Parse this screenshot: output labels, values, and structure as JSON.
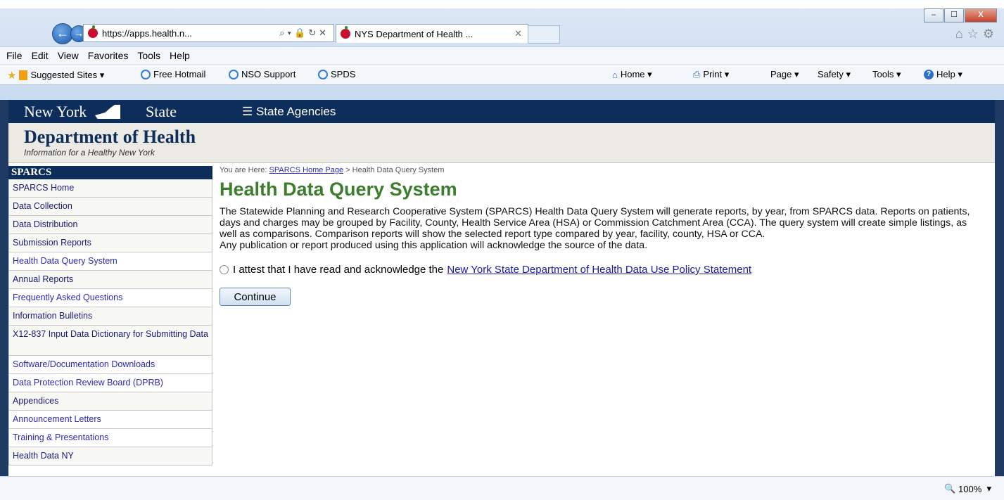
{
  "browser": {
    "url": "https://apps.health.n...",
    "tab_title": "NYS Department of Health ...",
    "menu": [
      "File",
      "Edit",
      "View",
      "Favorites",
      "Tools",
      "Help"
    ],
    "favorites": [
      "Suggested Sites ▾",
      "Free Hotmail",
      "NSO Support",
      "SPDS"
    ],
    "commands": [
      "Home  ▾",
      "Print  ▾",
      "Page ▾",
      "Safety ▾",
      "Tools ▾",
      "Help ▾"
    ],
    "zoom": "100%"
  },
  "header": {
    "ny_left": "New York",
    "ny_right": "State",
    "agencies": "☰ State Agencies",
    "dept_title": "Department of Health",
    "dept_sub": "Information for a Healthy New York"
  },
  "sidebar": {
    "title": "SPARCS",
    "items": [
      "SPARCS Home",
      "Data Collection",
      "Data Distribution",
      "Submission Reports",
      "Health Data Query System",
      "Annual Reports",
      "Frequently Asked Questions",
      "Information Bulletins",
      "X12-837 Input Data Dictionary for Submitting Data",
      "Software/Documentation Downloads",
      "Data Protection Review Board (DPRB)",
      "Appendices",
      "Announcement Letters",
      "Training & Presentations",
      "Health Data NY"
    ]
  },
  "main": {
    "crumb_prefix": "You are Here: ",
    "crumb_link": "SPARCS Home Page",
    "crumb_current": " > Health Data Query System",
    "title": "Health Data Query System",
    "para1": "The Statewide Planning and Research Cooperative System (SPARCS) Health Data Query System will generate reports, by year, from SPARCS data. Reports on patients, days and charges may be grouped by Facility, County, Health Service Area (HSA) or Commission Catchment Area (CCA). The query system will create simple listings, as well as comparisons. Comparison reports will show the selected report type compared by year, facility, county, HSA or CCA.",
    "para2": "Any publication or report produced using this application will acknowledge the source of the data.",
    "attest_text": "I attest that I have read and acknowledge the",
    "attest_link": "New York State Department of Health Data Use Policy Statement",
    "continue": "Continue"
  }
}
